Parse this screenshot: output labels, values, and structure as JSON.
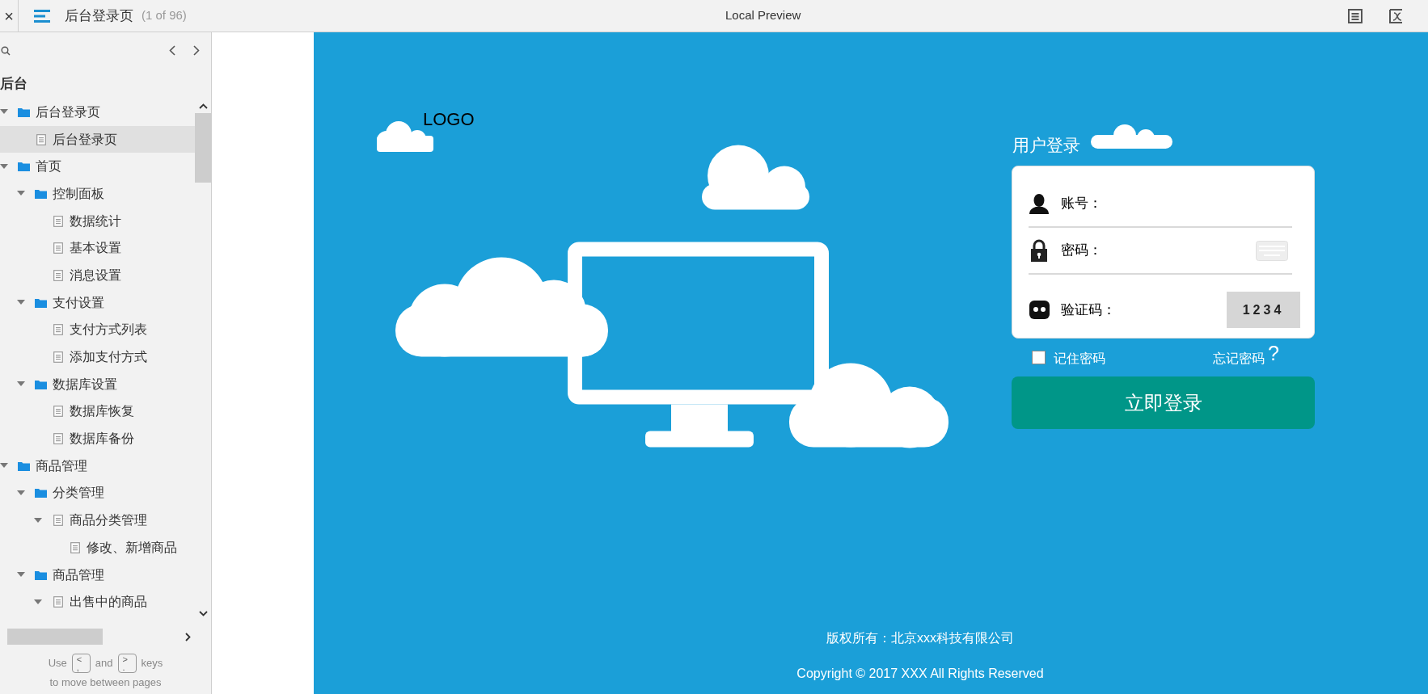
{
  "toolbar": {
    "close": "×",
    "page_title": "后台登录页",
    "page_count": "(1 of 96)",
    "center_title": "Local Preview"
  },
  "sidebar": {
    "section_title": "后台",
    "tree": [
      {
        "kind": "folder",
        "label": "后台登录页",
        "expanded": true,
        "selected": false,
        "children": [
          {
            "kind": "page",
            "label": "后台登录页",
            "selected": true
          }
        ]
      },
      {
        "kind": "folder",
        "label": "首页",
        "expanded": true,
        "selected": false,
        "children": [
          {
            "kind": "folder",
            "label": "控制面板",
            "expanded": true,
            "selected": false,
            "children": [
              {
                "kind": "page",
                "label": "数据统计",
                "selected": false
              },
              {
                "kind": "page",
                "label": "基本设置",
                "selected": false
              },
              {
                "kind": "page",
                "label": "消息设置",
                "selected": false
              }
            ]
          },
          {
            "kind": "folder",
            "label": "支付设置",
            "expanded": true,
            "selected": false,
            "children": [
              {
                "kind": "page",
                "label": "支付方式列表",
                "selected": false
              },
              {
                "kind": "page",
                "label": "添加支付方式",
                "selected": false
              }
            ]
          },
          {
            "kind": "folder",
            "label": "数据库设置",
            "expanded": true,
            "selected": false,
            "children": [
              {
                "kind": "page",
                "label": "数据库恢复",
                "selected": false
              },
              {
                "kind": "page",
                "label": "数据库备份",
                "selected": false
              }
            ]
          }
        ]
      },
      {
        "kind": "folder",
        "label": "商品管理",
        "expanded": true,
        "selected": false,
        "children": [
          {
            "kind": "folder",
            "label": "分类管理",
            "expanded": true,
            "selected": false,
            "children": [
              {
                "kind": "page",
                "label": "商品分类管理",
                "expanded": true,
                "selected": false,
                "children": [
                  {
                    "kind": "page",
                    "label": "修改、新增商品",
                    "selected": false
                  }
                ]
              }
            ]
          },
          {
            "kind": "folder",
            "label": "商品管理",
            "expanded": true,
            "selected": false,
            "children": [
              {
                "kind": "page",
                "label": "出售中的商品",
                "expanded": true,
                "selected": false
              }
            ]
          }
        ]
      }
    ],
    "hint": {
      "before": "Use",
      "keys": [
        {
          "top": "<",
          "bottom": ","
        },
        {
          "top": ">",
          "bottom": "."
        }
      ],
      "middle": "and",
      "after": "keys",
      "line2": "to move between pages"
    }
  },
  "login_page": {
    "logo": "LOGO",
    "form_title": "用户登录",
    "fields": [
      {
        "kind": "text",
        "label": "账号："
      },
      {
        "kind": "password",
        "label": "密码："
      },
      {
        "kind": "captcha",
        "label": "验证码：",
        "captcha": "1234"
      }
    ],
    "remember": {
      "label": "记住密码",
      "checked": false
    },
    "forgot": {
      "label": "忘记密码",
      "mark": "?"
    },
    "submit": "立即登录",
    "footer": [
      "版权所有：北京xxx科技有限公司",
      "Copyright © 2017 XXX All Rights Reserved"
    ]
  }
}
